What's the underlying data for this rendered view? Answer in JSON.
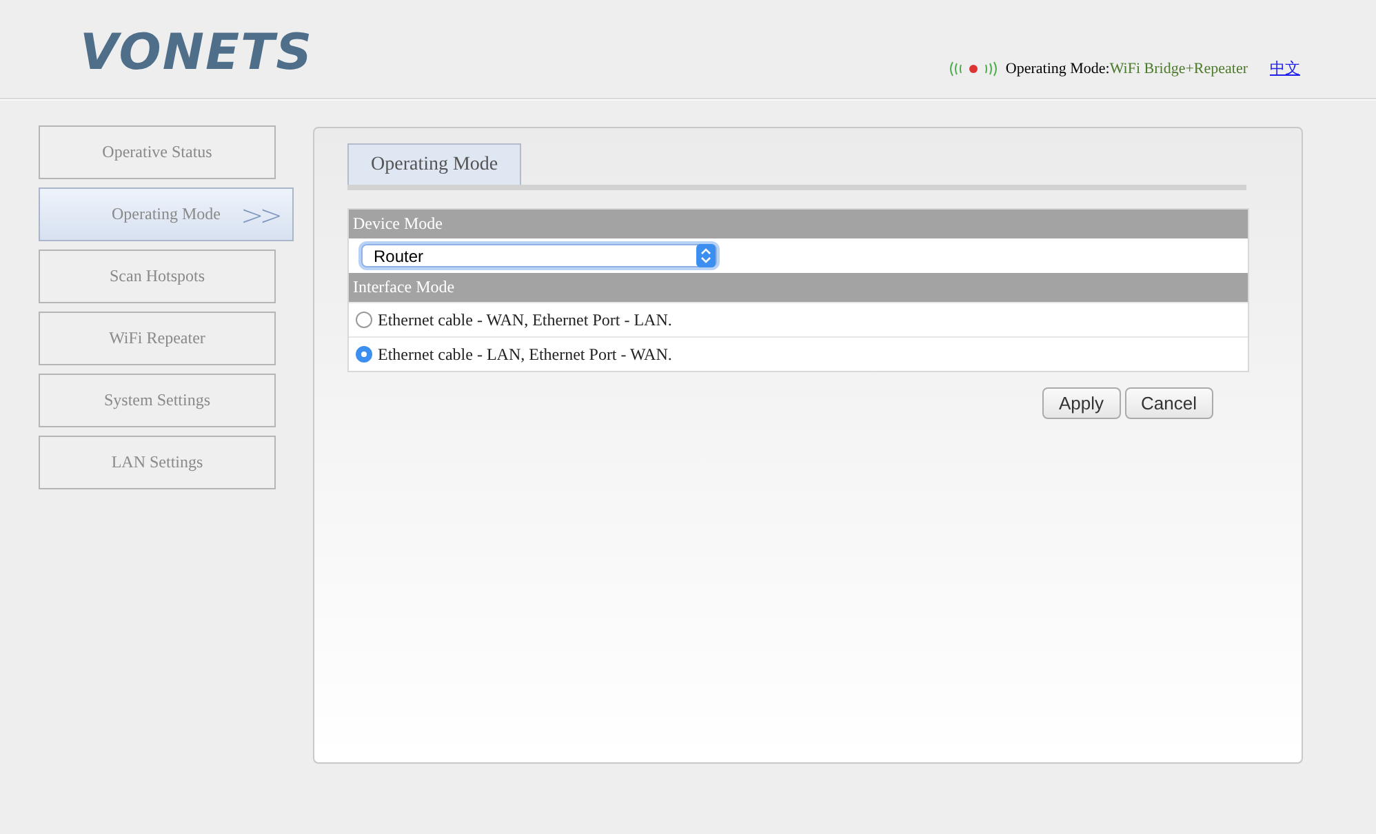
{
  "header": {
    "logo": "VONETS",
    "status_label": "Operating Mode:",
    "status_value": "WiFi Bridge+Repeater",
    "language_link": "中文"
  },
  "sidebar": {
    "items": [
      {
        "label": "Operative Status",
        "selected": false
      },
      {
        "label": "Operating Mode",
        "selected": true,
        "arrow": ">>"
      },
      {
        "label": "Scan Hotspots",
        "selected": false
      },
      {
        "label": "WiFi Repeater",
        "selected": false
      },
      {
        "label": "System Settings",
        "selected": false
      },
      {
        "label": "LAN Settings",
        "selected": false
      }
    ]
  },
  "tabs": [
    {
      "label": "Operating Mode",
      "selected": true
    }
  ],
  "device_mode": {
    "heading": "Device Mode",
    "select_value": "Router"
  },
  "interface_mode": {
    "heading": "Interface Mode",
    "options": [
      {
        "label": "Ethernet cable - WAN, Ethernet Port - LAN.",
        "selected": false
      },
      {
        "label": "Ethernet cable - LAN, Ethernet Port - WAN.",
        "selected": true
      }
    ]
  },
  "buttons": [
    "Apply",
    "Cancel"
  ]
}
